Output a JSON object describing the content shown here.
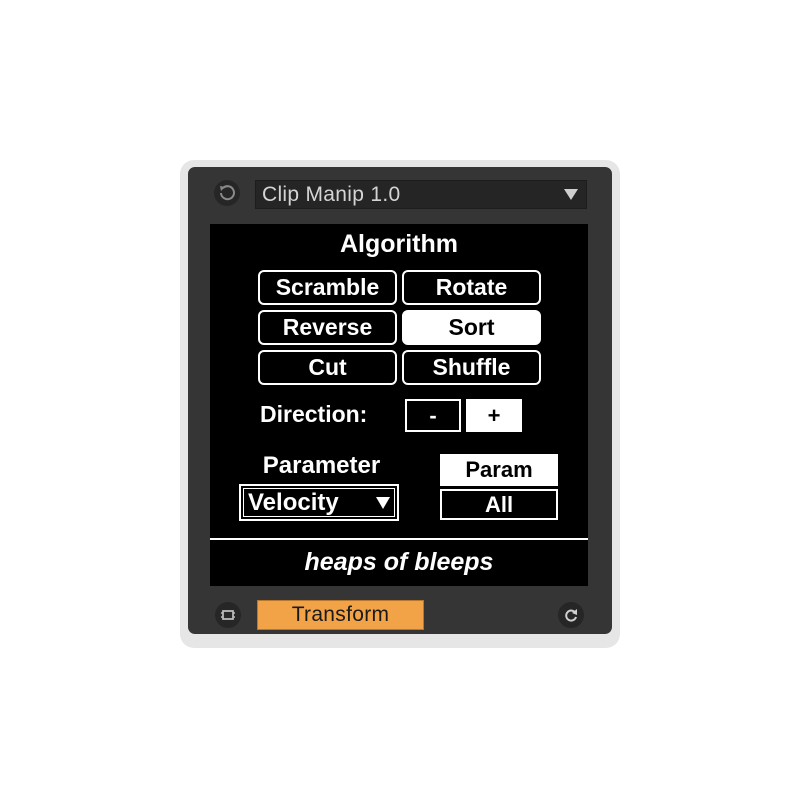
{
  "device": {
    "preset_name": "Clip Manip 1.0",
    "header_icon": "reset-circle-icon",
    "dropdown_icon": "triangle-down-icon"
  },
  "algorithm": {
    "heading": "Algorithm",
    "options": [
      "Scramble",
      "Rotate",
      "Reverse",
      "Sort",
      "Cut",
      "Shuffle"
    ],
    "selected": "Sort"
  },
  "direction": {
    "label": "Direction:",
    "minus": "-",
    "plus": "+",
    "selected": "+"
  },
  "parameter": {
    "heading": "Parameter",
    "value": "Velocity",
    "scope_param": "Param",
    "scope_all": "All",
    "scope_selected": "Param"
  },
  "tagline": "heaps of bleeps",
  "footer": {
    "transform_label": "Transform",
    "left_icon": "clip-icon",
    "right_icon": "refresh-icon"
  },
  "colors": {
    "accent": "#f2a348",
    "panel": "#000000",
    "frame": "#353535"
  }
}
